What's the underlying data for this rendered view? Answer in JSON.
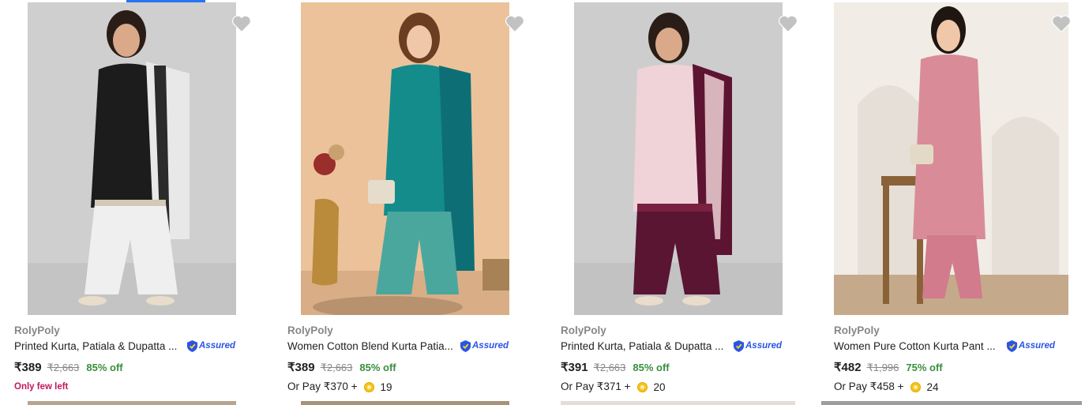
{
  "products": [
    {
      "brand": "RolyPoly",
      "title": "Printed Kurta, Patiala & Dupatta ...",
      "assured_label": "Assured",
      "price": "₹389",
      "mrp": "₹2,663",
      "discount": "85% off",
      "note": "Only few left",
      "pay_prefix": "",
      "coins": ""
    },
    {
      "brand": "RolyPoly",
      "title": "Women Cotton Blend Kurta Patia...",
      "assured_label": "Assured",
      "price": "₹389",
      "mrp": "₹2,663",
      "discount": "85% off",
      "note": "",
      "pay_prefix": "Or Pay ₹370 +",
      "coins": "19"
    },
    {
      "brand": "RolyPoly",
      "title": "Printed Kurta, Patiala & Dupatta ...",
      "assured_label": "Assured",
      "price": "₹391",
      "mrp": "₹2,663",
      "discount": "85% off",
      "note": "",
      "pay_prefix": "Or Pay ₹371 +",
      "coins": "20"
    },
    {
      "brand": "RolyPoly",
      "title": "Women Pure Cotton Kurta Pant ...",
      "assured_label": "Assured",
      "price": "₹482",
      "mrp": "₹1,996",
      "discount": "75% off",
      "note": "",
      "pay_prefix": "Or Pay ₹458 +",
      "coins": "24"
    }
  ],
  "icons": {
    "wishlist": "heart-icon",
    "assured": "shield-check-icon",
    "coin": "supercoin-icon"
  },
  "colors": {
    "accent": "#2874f0",
    "discount": "#388e3c",
    "low_stock": "#c2185b",
    "assured": "#2a55e5",
    "brand_text": "#878787"
  }
}
